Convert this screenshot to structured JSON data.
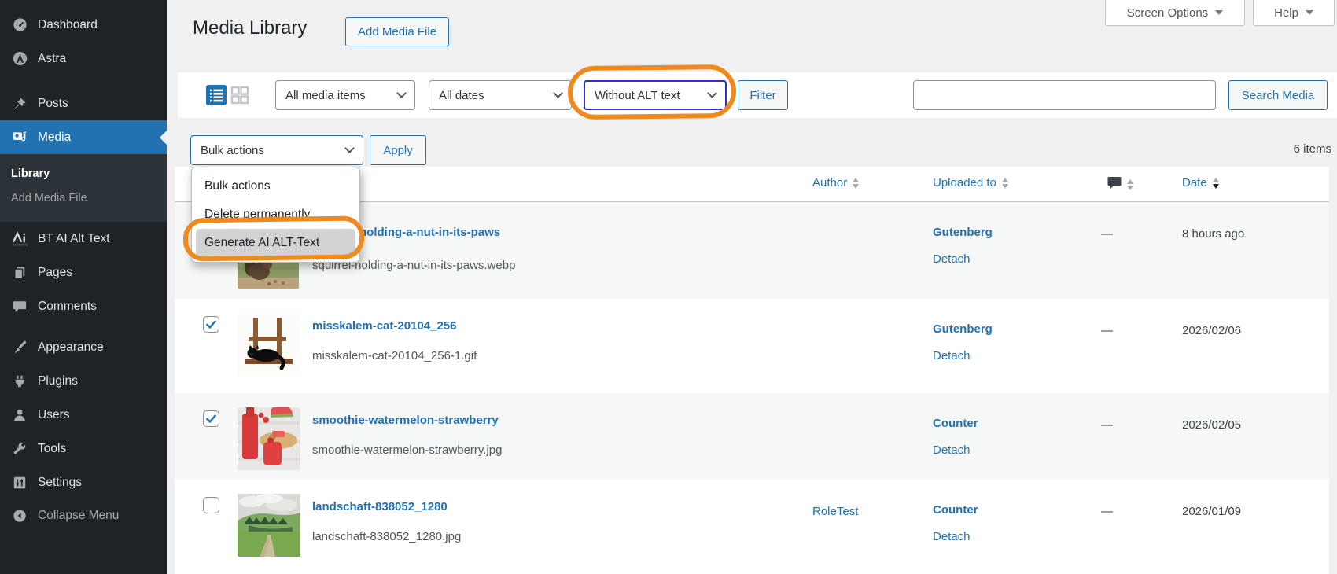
{
  "colors": {
    "accent": "#2271b1",
    "sidebar_bg": "#1d2327",
    "annotation_orange": "#ee8a20",
    "focus_blue": "#2b2fd4"
  },
  "sidebar": {
    "items": [
      {
        "label": "Dashboard"
      },
      {
        "label": "Astra"
      },
      {
        "label": "Posts"
      },
      {
        "label": "Media"
      },
      {
        "label": "BT AI Alt Text"
      },
      {
        "label": "Pages"
      },
      {
        "label": "Comments"
      },
      {
        "label": "Appearance"
      },
      {
        "label": "Plugins"
      },
      {
        "label": "Users"
      },
      {
        "label": "Tools"
      },
      {
        "label": "Settings"
      }
    ],
    "submenu": {
      "library": "Library",
      "add_media_file": "Add Media File"
    },
    "collapse_label": "Collapse Menu"
  },
  "topbar": {
    "screen_options": "Screen Options",
    "help": "Help"
  },
  "page": {
    "title": "Media Library",
    "add_button": "Add Media File"
  },
  "filters": {
    "media_type": "All media items",
    "date": "All dates",
    "alt_text": "Without ALT text",
    "filter_button": "Filter",
    "search_value": "",
    "search_button": "Search Media"
  },
  "bulk": {
    "selected": "Bulk actions",
    "apply_button": "Apply",
    "items_count": "6 items",
    "menu_options": [
      "Bulk actions",
      "Delete permanently",
      "Generate AI ALT-Text"
    ]
  },
  "table": {
    "headers": {
      "author": "Author",
      "uploaded_to": "Uploaded to",
      "comments_icon": "comment-bubble",
      "date": "Date"
    },
    "rows": [
      {
        "title": "squirrel-holding-a-nut-in-its-paws",
        "filename": "squirrel-holding-a-nut-in-its-paws.webp",
        "author": "",
        "uploaded_to": "Gutenberg",
        "detach": "Detach",
        "comments": "—",
        "date": "8 hours ago",
        "checked": false,
        "thumb": "squirrel-photo"
      },
      {
        "title": "misskalem-cat-20104_256",
        "filename": "misskalem-cat-20104_256-1.gif",
        "author": "",
        "uploaded_to": "Gutenberg",
        "detach": "Detach",
        "comments": "—",
        "date": "2026/02/06",
        "checked": true,
        "thumb": "black-cat-on-windowsill"
      },
      {
        "title": "smoothie-watermelon-strawberry",
        "filename": "smoothie-watermelon-strawberry.jpg",
        "author": "",
        "uploaded_to": "Counter",
        "detach": "Detach",
        "comments": "—",
        "date": "2026/02/05",
        "checked": true,
        "thumb": "smoothie-photo"
      },
      {
        "title": "landschaft-838052_1280",
        "filename": "landschaft-838052_1280.jpg",
        "author": "RoleTest",
        "uploaded_to": "Counter",
        "detach": "Detach",
        "comments": "—",
        "date": "2026/01/09",
        "checked": false,
        "thumb": "landscape-photo"
      }
    ]
  }
}
